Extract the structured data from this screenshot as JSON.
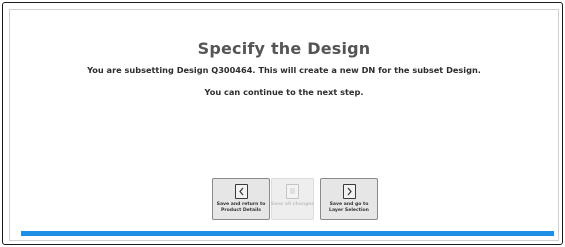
{
  "main": {
    "title": "Specify the Design",
    "subtitle": "You are subsetting Design Q300464. This will create a new DN for the subset Design.",
    "note": "You can continue to the next step."
  },
  "actions": {
    "back": {
      "label": "Save and return to Product Details",
      "icon": "chevron-left-icon"
    },
    "save": {
      "label": "Save all changes",
      "icon": "document-icon",
      "disabled": true
    },
    "next": {
      "label": "Save and go to Layer Selection",
      "icon": "chevron-right-icon"
    }
  },
  "colors": {
    "accent": "#1e8fe6",
    "title": "#555555"
  }
}
